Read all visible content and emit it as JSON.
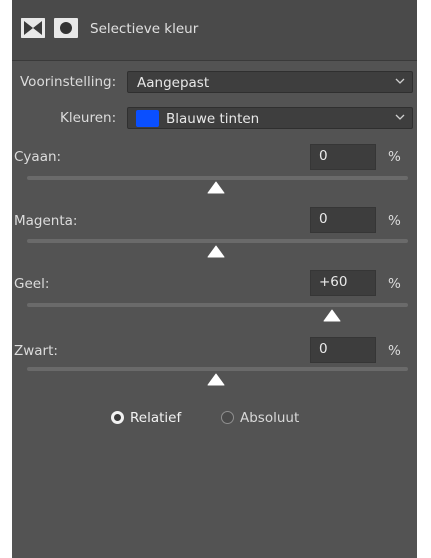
{
  "panel": {
    "title": "Selectieve kleur",
    "icons": [
      "adjustment-layer-icon",
      "layer-mask-icon"
    ]
  },
  "preset": {
    "label": "Voorinstelling:",
    "value": "Aangepast"
  },
  "colors": {
    "label": "Kleuren:",
    "value": "Blauwe tinten",
    "swatch": "#0a4fff"
  },
  "sliders": [
    {
      "label": "Cyaan:",
      "value": "0",
      "unit": "%",
      "level": 0
    },
    {
      "label": "Magenta:",
      "value": "0",
      "unit": "%",
      "level": 0
    },
    {
      "label": "Geel:",
      "value": "+60",
      "unit": "%",
      "level": 60
    },
    {
      "label": "Zwart:",
      "value": "0",
      "unit": "%",
      "level": 0
    }
  ],
  "method": {
    "options": [
      {
        "label": "Relatief",
        "selected": true
      },
      {
        "label": "Absoluut",
        "selected": false
      }
    ]
  },
  "colors_theme": {
    "panel": "#535353",
    "accent_swatch": "#0a4fff"
  }
}
